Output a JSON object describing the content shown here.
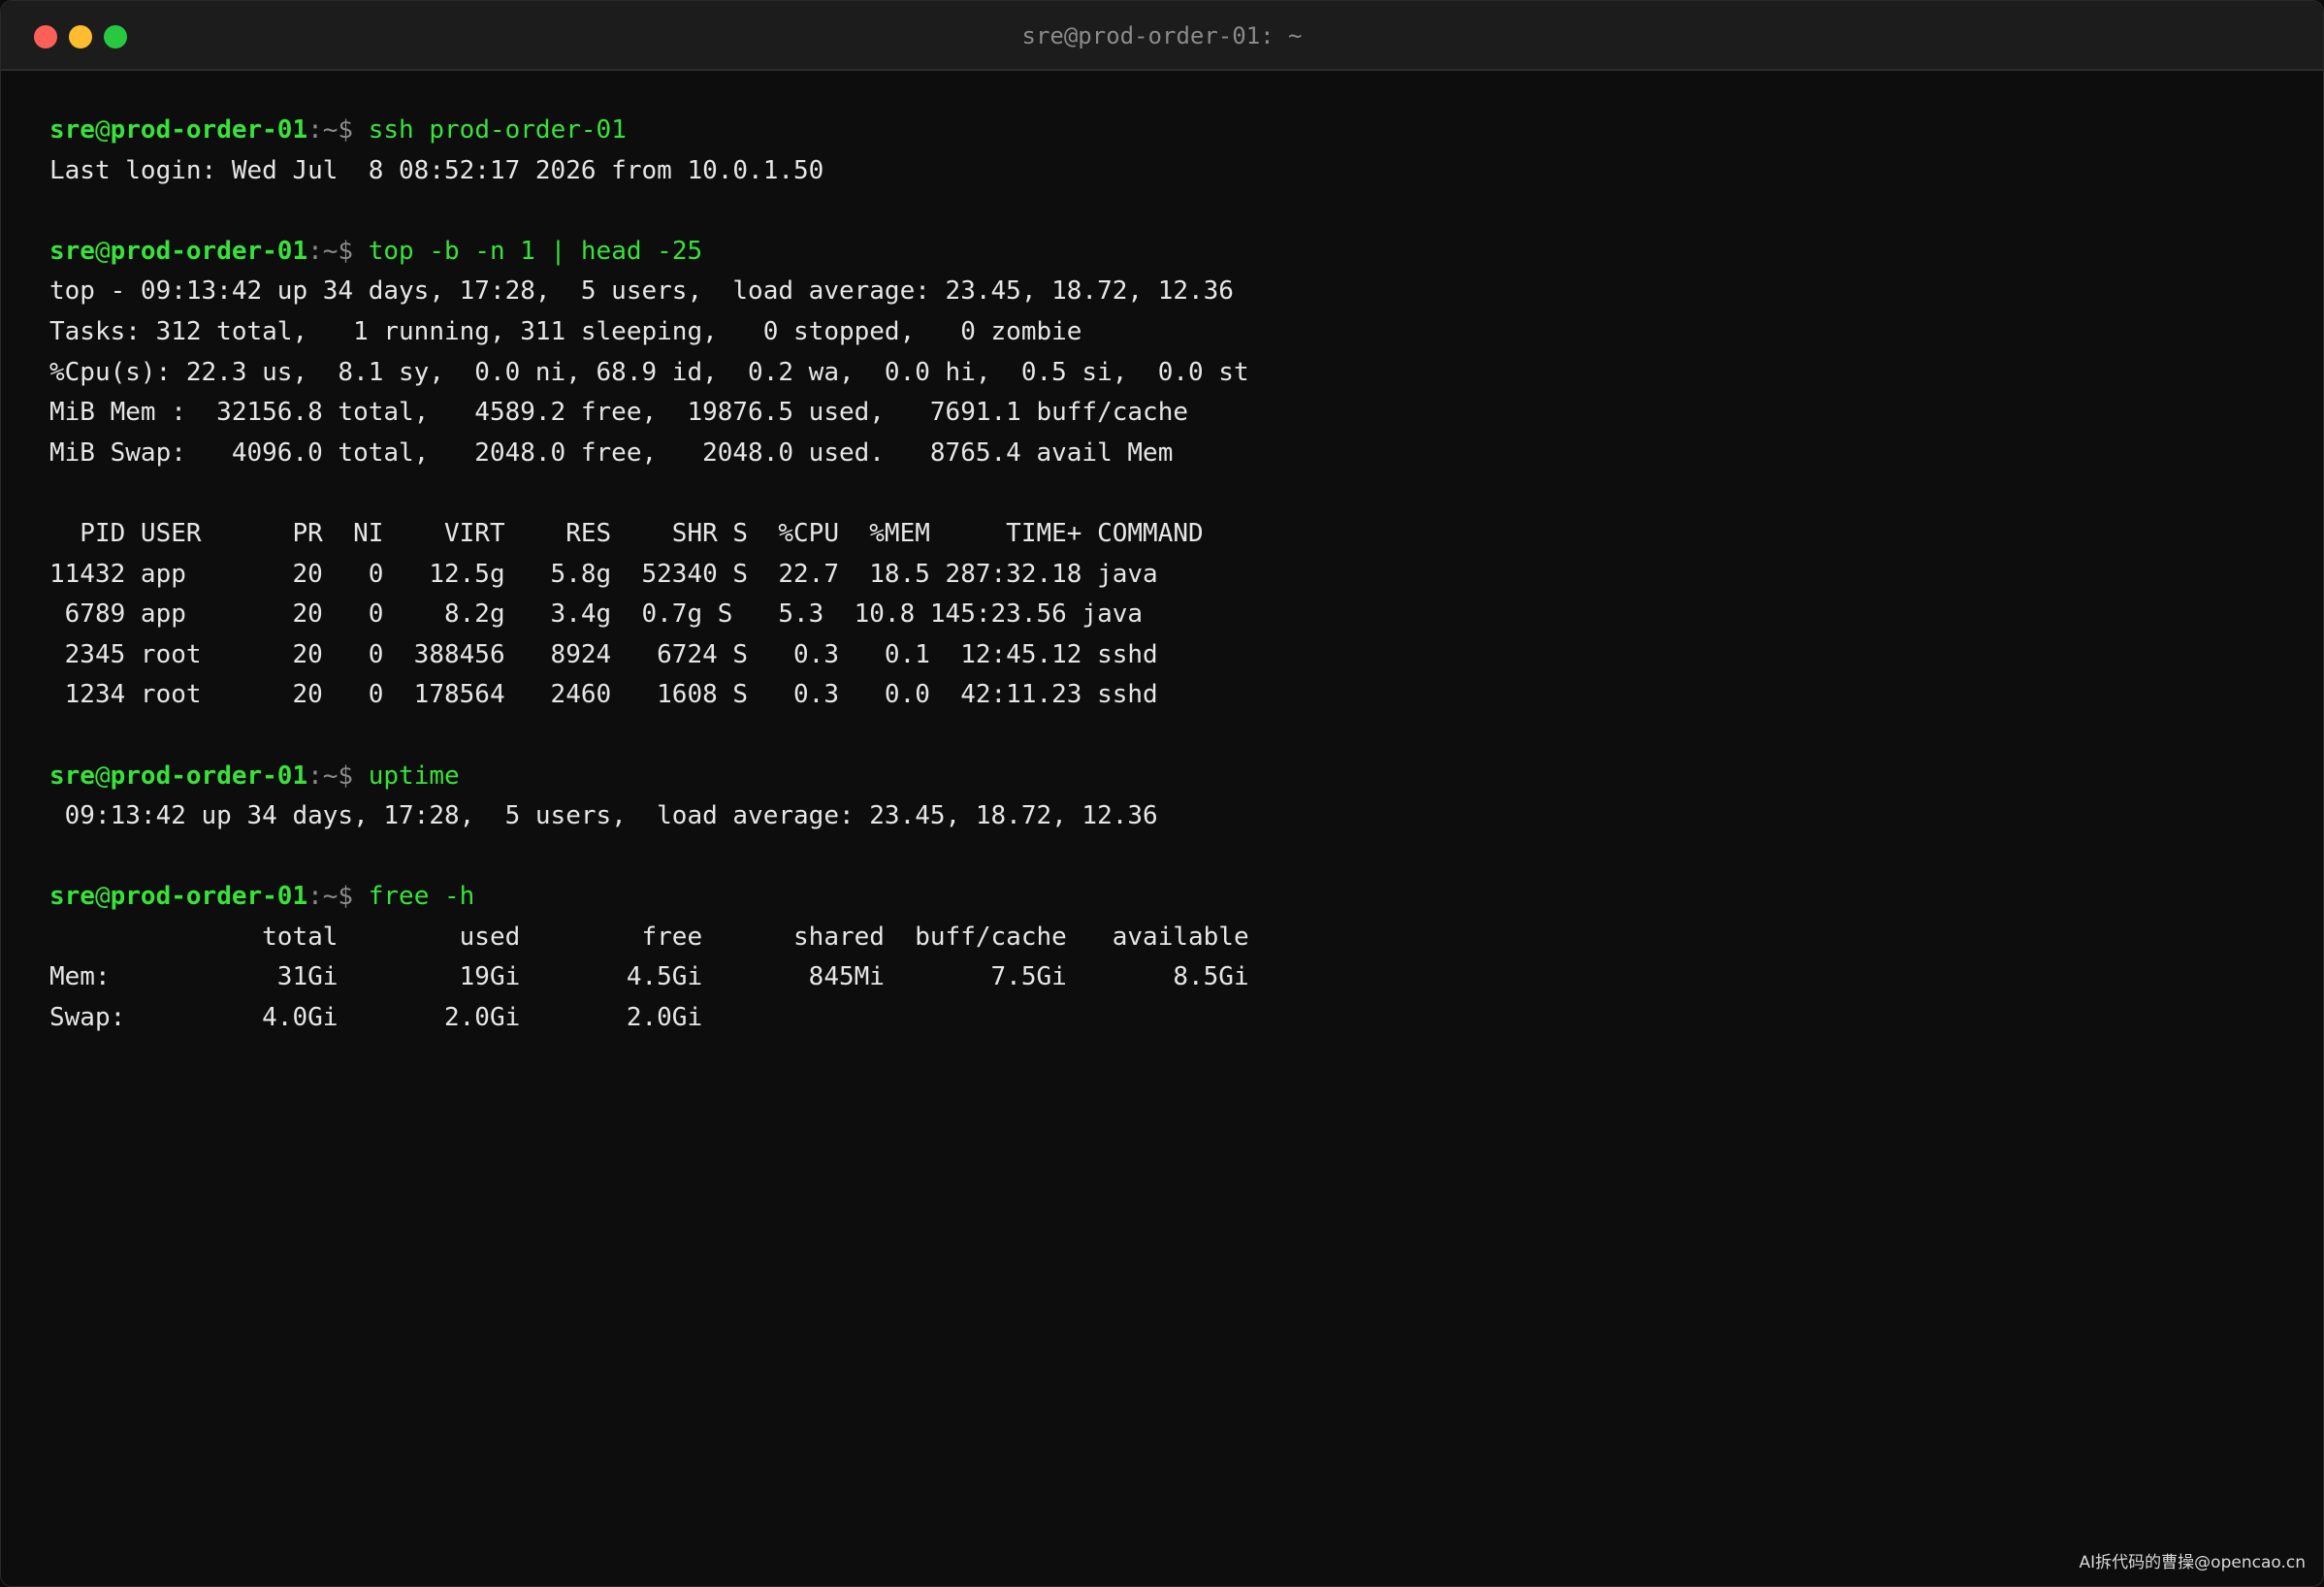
{
  "window": {
    "title": "sre@prod-order-01: ~",
    "colors": {
      "close": "#fe5f57",
      "minimize": "#febc2e",
      "zoom": "#28c840",
      "prompt": "#38e23a",
      "text": "#e6e6e6",
      "background": "#0d0d0d"
    }
  },
  "prompt": {
    "user": "sre",
    "at": "@",
    "host": "prod-order-01",
    "sep": ":~$ "
  },
  "terminal": {
    "lines": [
      {
        "type": "command",
        "cmd": "ssh prod-order-01"
      },
      {
        "type": "output",
        "text": "Last login: Wed Jul  8 08:52:17 2026 from 10.0.1.50"
      },
      {
        "type": "blank"
      },
      {
        "type": "command",
        "cmd": "top -b -n 1 | head -25"
      },
      {
        "type": "output",
        "text": "top - 09:13:42 up 34 days, 17:28,  5 users,  load average: 23.45, 18.72, 12.36"
      },
      {
        "type": "output",
        "text": "Tasks: 312 total,   1 running, 311 sleeping,   0 stopped,   0 zombie"
      },
      {
        "type": "output",
        "text": "%Cpu(s): 22.3 us,  8.1 sy,  0.0 ni, 68.9 id,  0.2 wa,  0.0 hi,  0.5 si,  0.0 st"
      },
      {
        "type": "output",
        "text": "MiB Mem :  32156.8 total,   4589.2 free,  19876.5 used,   7691.1 buff/cache"
      },
      {
        "type": "output",
        "text": "MiB Swap:   4096.0 total,   2048.0 free,   2048.0 used.   8765.4 avail Mem"
      },
      {
        "type": "blank"
      },
      {
        "type": "output",
        "text": "  PID USER      PR  NI    VIRT    RES    SHR S  %CPU  %MEM     TIME+ COMMAND"
      },
      {
        "type": "output",
        "text": "11432 app       20   0   12.5g   5.8g  52340 S  22.7  18.5 287:32.18 java"
      },
      {
        "type": "output",
        "text": " 6789 app       20   0    8.2g   3.4g  0.7g S   5.3  10.8 145:23.56 java"
      },
      {
        "type": "output",
        "text": " 2345 root      20   0  388456   8924   6724 S   0.3   0.1  12:45.12 sshd"
      },
      {
        "type": "output",
        "text": " 1234 root      20   0  178564   2460   1608 S   0.3   0.0  42:11.23 sshd"
      },
      {
        "type": "blank"
      },
      {
        "type": "command",
        "cmd": "uptime"
      },
      {
        "type": "output",
        "text": " 09:13:42 up 34 days, 17:28,  5 users,  load average: 23.45, 18.72, 12.36"
      },
      {
        "type": "blank"
      },
      {
        "type": "command",
        "cmd": "free -h"
      },
      {
        "type": "output",
        "text": "              total        used        free      shared  buff/cache   available"
      },
      {
        "type": "output",
        "text": "Mem:           31Gi        19Gi       4.5Gi       845Mi       7.5Gi       8.5Gi"
      },
      {
        "type": "output",
        "text": "Swap:         4.0Gi       2.0Gi       2.0Gi"
      }
    ]
  },
  "watermark": "AI拆代码的曹操@opencao.cn"
}
